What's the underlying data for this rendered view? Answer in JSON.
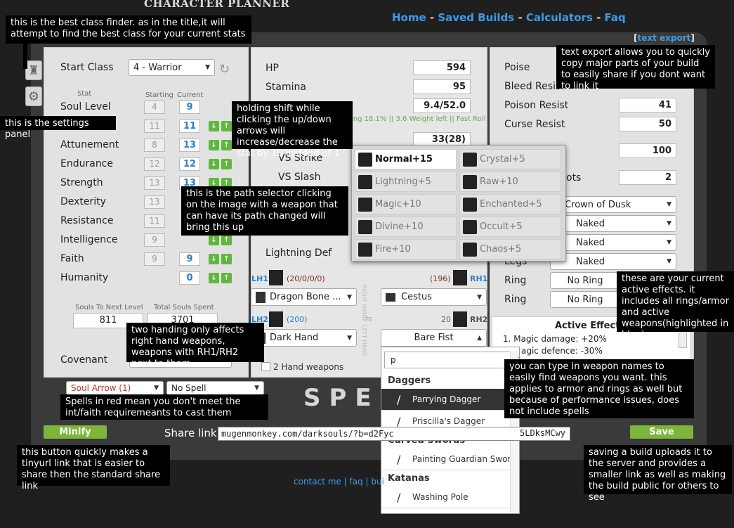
{
  "header": {
    "logo": "CHARACTER PLANNER",
    "nav": [
      "Home",
      "Saved Builds",
      "Calculators",
      "Faq"
    ],
    "text_export": "text export"
  },
  "left": {
    "start_class_label": "Start Class",
    "start_class_value": "4 - Warrior",
    "col_stat": "Stat",
    "col_starting": "Starting",
    "col_current": "Current",
    "stats": [
      {
        "name": "Soul Level",
        "start": "4",
        "cur": "9"
      },
      {
        "name": "",
        "start": "11",
        "cur": "11"
      },
      {
        "name": "Attunement",
        "start": "8",
        "cur": "13"
      },
      {
        "name": "Endurance",
        "start": "12",
        "cur": "12"
      },
      {
        "name": "Strength",
        "start": "13",
        "cur": "13"
      },
      {
        "name": "Dexterity",
        "start": "13",
        "cur": ""
      },
      {
        "name": "Resistance",
        "start": "11",
        "cur": ""
      },
      {
        "name": "Intelligence",
        "start": "9",
        "cur": ""
      },
      {
        "name": "Faith",
        "start": "9",
        "cur": "9"
      },
      {
        "name": "Humanity",
        "start": "",
        "cur": "0"
      }
    ],
    "souls_next_label": "Souls To Next Level",
    "souls_next_value": "811",
    "souls_spent_label": "Total Souls Spent",
    "souls_spent_value": "3701",
    "covenant_label": "Covenant",
    "spell1": "Soul Arrow (1)",
    "spell2": "No Spell"
  },
  "mid": {
    "hp_label": "HP",
    "hp": "594",
    "stamina_label": "Stamina",
    "stamina": "95",
    "weight": "9.4/52.0",
    "weight_info": "ing 18.1% || 3.6 Weight left || Fast Roll",
    "def": "33(28)",
    "vs_strike": "VS Strike",
    "vs_slash": "VS Slash",
    "lightning_def": "Lightning Def",
    "lh1": "LH1",
    "lh1_vals": "(20/0/0/0)",
    "rh1_vals": "(196)",
    "rh1": "RH1",
    "lh1_weapon": "Dragon Bone ...",
    "rh1_weapon": "Cestus",
    "lh2": "LH2",
    "lh2_vals": "(200)",
    "rh2_vals": "20",
    "rh2": "RH2",
    "lh2_weapon": "Dark Hand",
    "rh2_weapon": "Bare Fist",
    "left_hand_vertical": "LEFT HAND",
    "right_hand_vertical": "RIGHT HAND",
    "two_hand_label": "2 Hand weapons",
    "spells_watermark": "SPELLS"
  },
  "right": {
    "poise": "Poise",
    "bleed": "Bleed Resist",
    "bleed_val": "",
    "poison": "Poison Resist",
    "poison_val": "41",
    "curse": "Curse Resist",
    "curse_val": "50",
    "equip_load_val": "100",
    "slots_label": "ots",
    "slots_val": "2",
    "head": "Crown of Dusk",
    "chest": "Naked",
    "hands": "Naked",
    "legs_label": "Legs",
    "legs": "Naked",
    "ring1_label": "Ring",
    "ring1": "No Ring",
    "ring2_label": "Ring",
    "ring2": "No Ring",
    "effects_title": "Active Effects",
    "effect1": "1.  Magic damage: +20%",
    "effect2": "agic defence: -30%"
  },
  "popup": {
    "paths": [
      "Normal+15",
      "Crystal+5",
      "Lightning+5",
      "Raw+10",
      "Magic+10",
      "Enchanted+5",
      "Divine+10",
      "Occult+5",
      "Fire+10",
      "Chaos+5"
    ]
  },
  "dropdown": {
    "search": "p",
    "groups": [
      {
        "name": "Daggers",
        "items": [
          "Parrying Dagger",
          "Priscilla's Dagger"
        ]
      },
      {
        "name": "Curved Swords",
        "items": [
          "Painting Guardian Sword"
        ]
      },
      {
        "name": "Katanas",
        "items": [
          "Washing Pole"
        ]
      }
    ]
  },
  "bottom": {
    "minify": "Minify",
    "share_label": "Share link",
    "share_url": "mugenmonkey.com/darksouls/?b=d2Fyc",
    "share_url_tail": "5LDksMCwy",
    "save": "Save",
    "footer": "contact me | faq | bui"
  },
  "annotations": {
    "class_finder": "this is the best class finder.  as in the title,it will attempt to find the best class for your current stats",
    "settings": "this is the settings panel",
    "shift": "holding shift while clicking the up/down arrows will increase/decrease the stat by 10 instead of 1",
    "path": "this is the path selector clicking on the image with a weapon that can have its path changed will bring this up",
    "two_hand": "two handing only affects right hand weapons, weapons with RH1/RH2 next to them",
    "spells": "Spells in red mean you don't meet the int/faith requiremeants to cast them",
    "minify": "this button quickly makes a tinyurl link that is easier to share then the standard share link",
    "text_export": "text export allows you to quickly copy major parts of your build to easily share if you dont want to link it",
    "effects": "these are your current active effects. it includes all rings/armor and active weapons(highlighted in blue)",
    "type_names": "you can type in weapon names to easily find weapons you want. this applies to armor and rings as well but because of performance issues, does not include spells",
    "save": "saving a build uploads it to the server and provides a smaller link as well as making the build public for others to see"
  }
}
